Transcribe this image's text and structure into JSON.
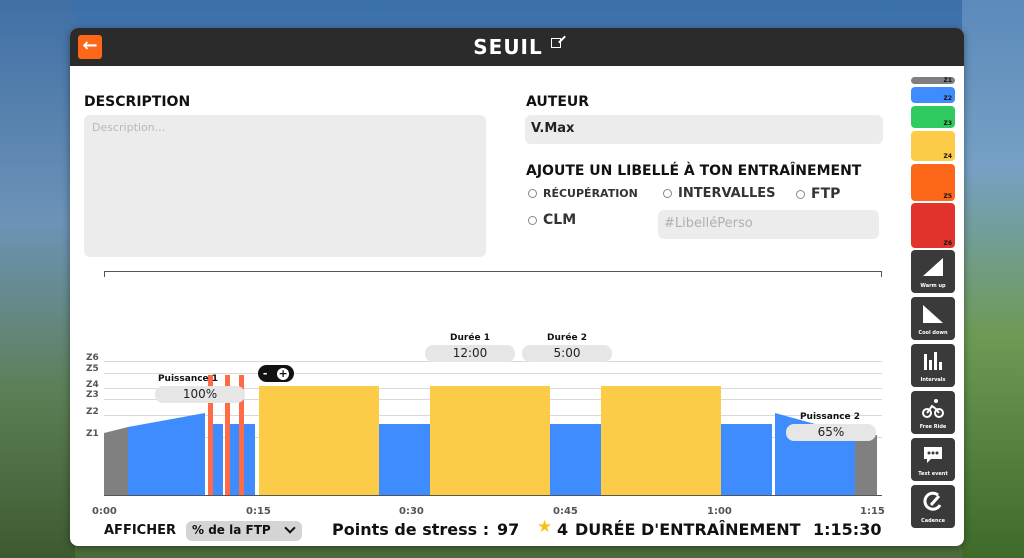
{
  "header": {
    "title": "SEUIL"
  },
  "description": {
    "label": "DESCRIPTION",
    "placeholder": "Description..."
  },
  "author": {
    "label": "AUTEUR",
    "value": "V.Max"
  },
  "tags": {
    "label": "AJOUTE UN LIBELLÉ À TON ENTRAÎNEMENT",
    "options": [
      "RÉCUPÉRATION",
      "INTERVALLES",
      "FTP",
      "CLM"
    ],
    "custom_placeholder": "#LibelléPerso"
  },
  "workout": {
    "zones": [
      "Z6",
      "Z5",
      "Z4",
      "Z3",
      "Z2",
      "Z1"
    ],
    "ticks": [
      "0:00",
      "0:15",
      "0:30",
      "0:45",
      "1:00",
      "1:15"
    ],
    "duree1": {
      "label": "Durée 1",
      "value": "12:00"
    },
    "duree2": {
      "label": "Durée 2",
      "value": "5:00"
    },
    "puissance1": {
      "label": "Puissance 1",
      "value": "100%"
    },
    "puissance2": {
      "label": "Puissance 2",
      "value": "65%"
    },
    "stepper": {
      "minus": "-",
      "plus": "+"
    },
    "colors": {
      "z2": "#3f8cff",
      "z4": "#fccb47",
      "z6": "#ff6b47",
      "warm": "#808080"
    }
  },
  "footer": {
    "show_label": "AFFICHER",
    "dropdown_value": "% de la FTP",
    "stress_label": "Points de stress :",
    "stress_value": "97",
    "star_value": "4",
    "duration_label": "DURÉE D'ENTRAÎNEMENT",
    "duration_value": "1:15:30"
  },
  "sidebar": {
    "zones": [
      {
        "label": "Z1",
        "color": "#7f7f7f"
      },
      {
        "label": "Z2",
        "color": "#3f8cff"
      },
      {
        "label": "Z3",
        "color": "#2fcb60"
      },
      {
        "label": "Z4",
        "color": "#fccb47"
      },
      {
        "label": "Z5",
        "color": "#fc6719"
      },
      {
        "label": "Z6",
        "color": "#e1332c"
      }
    ],
    "tools": [
      "Warm up",
      "Cool down",
      "Intervals",
      "Free Ride",
      "Text event",
      "Cadence"
    ]
  }
}
